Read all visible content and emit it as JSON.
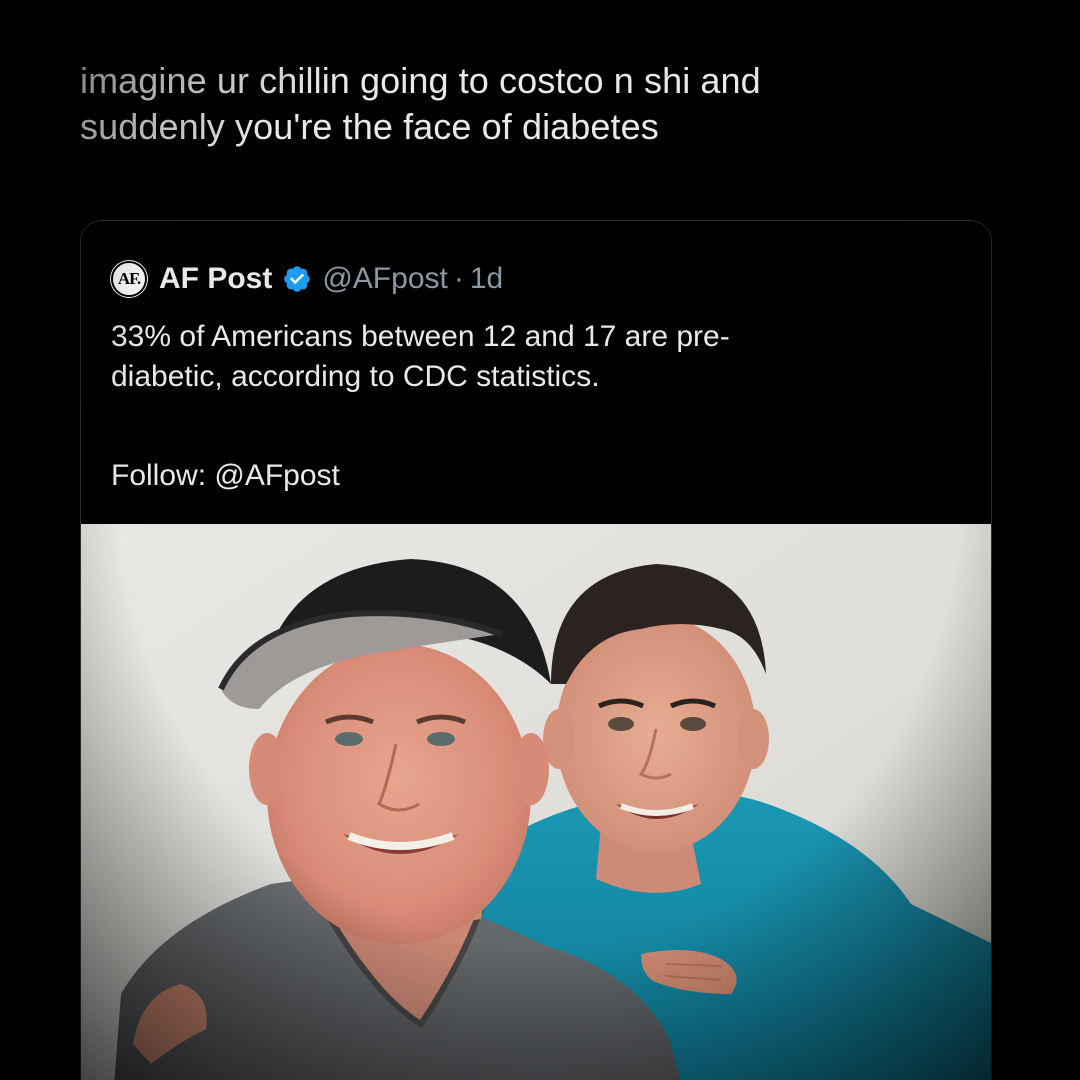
{
  "tweet": {
    "text_line1": "imagine ur chillin going to costco n shi and",
    "text_line2": "suddenly you're the face of diabetes"
  },
  "quoted_tweet": {
    "avatar_text": "AF.",
    "display_name": "AF Post",
    "verified": true,
    "handle": "@AFpost",
    "separator": "·",
    "time": "1d",
    "body_line1": "33% of Americans between 12 and 17 are pre-",
    "body_line2": "diabetic, according to CDC statistics.",
    "follow_text": "Follow: @AFpost",
    "media": {
      "type": "photo"
    }
  },
  "colors": {
    "background": "#000000",
    "text_primary": "#e7e9ea",
    "text_secondary": "#8b98a5",
    "verified_badge": "#1d9bf0",
    "card_border": "#2f3336"
  }
}
